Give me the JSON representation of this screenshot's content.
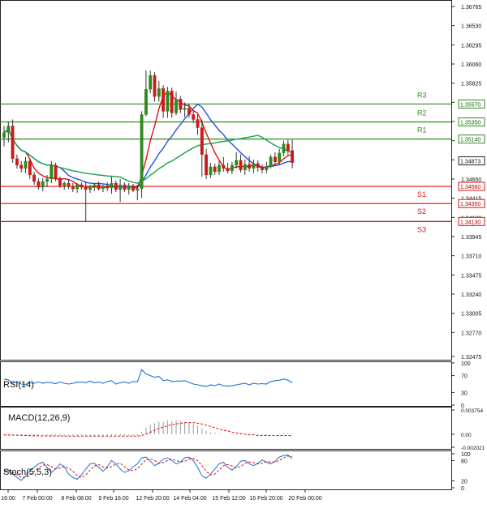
{
  "chart_data": [
    {
      "type": "candlestick",
      "title": "",
      "ylim": [
        1.32475,
        1.36765
      ],
      "y_ticks": [
        "1.36765",
        "1.36530",
        "1.36295",
        "1.36060",
        "1.35825",
        "1.35590",
        "1.35355",
        "1.35120",
        "1.34885",
        "1.34650",
        "1.34415",
        "1.34180",
        "1.33945",
        "1.33710",
        "1.33475",
        "1.33240",
        "1.33005",
        "1.32770",
        "1.32475"
      ],
      "x_ticks": [
        "16:00",
        "7 Feb 00:00",
        "8 Feb 08:00",
        "9 Feb 16:00",
        "12 Feb 20:00",
        "14 Feb 04:00",
        "15 Feb 12:00",
        "16 Feb 20:00",
        "20 Feb 00:00"
      ],
      "current_price": "1.34873",
      "levels": [
        {
          "name": "R3",
          "value": 1.3557,
          "label": "1.35570",
          "color": "#2e8b1e"
        },
        {
          "name": "R2",
          "value": 1.3535,
          "label": "1.35350",
          "color": "#2e8b1e"
        },
        {
          "name": "R1",
          "value": 1.3514,
          "label": "1.35140",
          "color": "#2e8b1e"
        },
        {
          "name": "S1",
          "value": 1.3456,
          "label": "1.34560",
          "color": "#e01010"
        },
        {
          "name": "S2",
          "value": 1.3435,
          "label": "1.34350",
          "color": "#e01010"
        },
        {
          "name": "S3",
          "value": 1.3413,
          "label": "1.34130",
          "color": "#e01010"
        }
      ],
      "candles": [
        {
          "o": 1.3516,
          "h": 1.353,
          "l": 1.3505,
          "c": 1.3522
        },
        {
          "o": 1.3522,
          "h": 1.3535,
          "l": 1.351,
          "c": 1.353
        },
        {
          "o": 1.353,
          "h": 1.3538,
          "l": 1.3485,
          "c": 1.349
        },
        {
          "o": 1.349,
          "h": 1.3495,
          "l": 1.3478,
          "c": 1.3482
        },
        {
          "o": 1.3482,
          "h": 1.3487,
          "l": 1.3473,
          "c": 1.3478
        },
        {
          "o": 1.3478,
          "h": 1.3492,
          "l": 1.3472,
          "c": 1.3487
        },
        {
          "o": 1.3487,
          "h": 1.349,
          "l": 1.3465,
          "c": 1.347
        },
        {
          "o": 1.347,
          "h": 1.3474,
          "l": 1.3458,
          "c": 1.3462
        },
        {
          "o": 1.3462,
          "h": 1.3466,
          "l": 1.3452,
          "c": 1.3455
        },
        {
          "o": 1.3455,
          "h": 1.3466,
          "l": 1.345,
          "c": 1.3462
        },
        {
          "o": 1.3462,
          "h": 1.347,
          "l": 1.3455,
          "c": 1.3465
        },
        {
          "o": 1.3465,
          "h": 1.3487,
          "l": 1.346,
          "c": 1.3482
        },
        {
          "o": 1.3482,
          "h": 1.3485,
          "l": 1.3462,
          "c": 1.3466
        },
        {
          "o": 1.3466,
          "h": 1.3468,
          "l": 1.3454,
          "c": 1.3457
        },
        {
          "o": 1.3457,
          "h": 1.3462,
          "l": 1.3452,
          "c": 1.346
        },
        {
          "o": 1.346,
          "h": 1.3465,
          "l": 1.3453,
          "c": 1.3456
        },
        {
          "o": 1.3456,
          "h": 1.346,
          "l": 1.3449,
          "c": 1.3453
        },
        {
          "o": 1.3453,
          "h": 1.346,
          "l": 1.3448,
          "c": 1.3458
        },
        {
          "o": 1.3458,
          "h": 1.3461,
          "l": 1.3452,
          "c": 1.3455
        },
        {
          "o": 1.3455,
          "h": 1.3462,
          "l": 1.3413,
          "c": 1.3452
        },
        {
          "o": 1.3452,
          "h": 1.3458,
          "l": 1.3448,
          "c": 1.3456
        },
        {
          "o": 1.3456,
          "h": 1.346,
          "l": 1.345,
          "c": 1.3458
        },
        {
          "o": 1.3458,
          "h": 1.3462,
          "l": 1.3451,
          "c": 1.3453
        },
        {
          "o": 1.3453,
          "h": 1.3458,
          "l": 1.3449,
          "c": 1.3456
        },
        {
          "o": 1.3456,
          "h": 1.3461,
          "l": 1.345,
          "c": 1.3454
        },
        {
          "o": 1.3454,
          "h": 1.3468,
          "l": 1.3447,
          "c": 1.346
        },
        {
          "o": 1.346,
          "h": 1.3463,
          "l": 1.3449,
          "c": 1.3452
        },
        {
          "o": 1.3452,
          "h": 1.3465,
          "l": 1.3437,
          "c": 1.3458
        },
        {
          "o": 1.3458,
          "h": 1.3461,
          "l": 1.3449,
          "c": 1.3452
        },
        {
          "o": 1.3452,
          "h": 1.346,
          "l": 1.3446,
          "c": 1.3457
        },
        {
          "o": 1.3457,
          "h": 1.3459,
          "l": 1.3449,
          "c": 1.3451
        },
        {
          "o": 1.3451,
          "h": 1.3458,
          "l": 1.3439,
          "c": 1.3453
        },
        {
          "o": 1.3453,
          "h": 1.3548,
          "l": 1.3442,
          "c": 1.3544
        },
        {
          "o": 1.3544,
          "h": 1.3598,
          "l": 1.3542,
          "c": 1.3575
        },
        {
          "o": 1.3575,
          "h": 1.3598,
          "l": 1.357,
          "c": 1.3592
        },
        {
          "o": 1.3592,
          "h": 1.3596,
          "l": 1.356,
          "c": 1.3566
        },
        {
          "o": 1.3566,
          "h": 1.3585,
          "l": 1.356,
          "c": 1.3576
        },
        {
          "o": 1.3576,
          "h": 1.358,
          "l": 1.354,
          "c": 1.3548
        },
        {
          "o": 1.3548,
          "h": 1.3578,
          "l": 1.354,
          "c": 1.3573
        },
        {
          "o": 1.3573,
          "h": 1.3577,
          "l": 1.354,
          "c": 1.3546
        },
        {
          "o": 1.3546,
          "h": 1.3572,
          "l": 1.3543,
          "c": 1.3563
        },
        {
          "o": 1.3563,
          "h": 1.3567,
          "l": 1.3546,
          "c": 1.355
        },
        {
          "o": 1.355,
          "h": 1.3559,
          "l": 1.3541,
          "c": 1.3552
        },
        {
          "o": 1.3552,
          "h": 1.3557,
          "l": 1.354,
          "c": 1.3544
        },
        {
          "o": 1.3544,
          "h": 1.3549,
          "l": 1.3534,
          "c": 1.3538
        },
        {
          "o": 1.3538,
          "h": 1.3544,
          "l": 1.3519,
          "c": 1.3528
        },
        {
          "o": 1.3528,
          "h": 1.3538,
          "l": 1.3468,
          "c": 1.3495
        },
        {
          "o": 1.3495,
          "h": 1.3502,
          "l": 1.3465,
          "c": 1.347
        },
        {
          "o": 1.347,
          "h": 1.3485,
          "l": 1.3466,
          "c": 1.348
        },
        {
          "o": 1.348,
          "h": 1.3484,
          "l": 1.347,
          "c": 1.3474
        },
        {
          "o": 1.3474,
          "h": 1.3487,
          "l": 1.347,
          "c": 1.3482
        },
        {
          "o": 1.3482,
          "h": 1.3492,
          "l": 1.3474,
          "c": 1.3478
        },
        {
          "o": 1.3478,
          "h": 1.3485,
          "l": 1.3472,
          "c": 1.3475
        },
        {
          "o": 1.3475,
          "h": 1.3486,
          "l": 1.3471,
          "c": 1.3482
        },
        {
          "o": 1.3482,
          "h": 1.3498,
          "l": 1.3478,
          "c": 1.3488
        },
        {
          "o": 1.3488,
          "h": 1.3495,
          "l": 1.3473,
          "c": 1.3476
        },
        {
          "o": 1.3476,
          "h": 1.3489,
          "l": 1.347,
          "c": 1.3483
        },
        {
          "o": 1.3483,
          "h": 1.3493,
          "l": 1.3474,
          "c": 1.3478
        },
        {
          "o": 1.3478,
          "h": 1.3489,
          "l": 1.3472,
          "c": 1.3484
        },
        {
          "o": 1.3484,
          "h": 1.3488,
          "l": 1.3474,
          "c": 1.3479
        },
        {
          "o": 1.3479,
          "h": 1.3483,
          "l": 1.3472,
          "c": 1.3476
        },
        {
          "o": 1.3476,
          "h": 1.3486,
          "l": 1.3472,
          "c": 1.348
        },
        {
          "o": 1.348,
          "h": 1.3495,
          "l": 1.3478,
          "c": 1.3492
        },
        {
          "o": 1.3492,
          "h": 1.3498,
          "l": 1.3483,
          "c": 1.3486
        },
        {
          "o": 1.3486,
          "h": 1.3502,
          "l": 1.3482,
          "c": 1.3497
        },
        {
          "o": 1.3497,
          "h": 1.3512,
          "l": 1.3493,
          "c": 1.3508
        },
        {
          "o": 1.3508,
          "h": 1.3513,
          "l": 1.3495,
          "c": 1.35
        },
        {
          "o": 1.35,
          "h": 1.3513,
          "l": 1.3478,
          "c": 1.3485
        }
      ],
      "ma_fast_color": "#e01010",
      "ma_mid_color": "#2a4fd8",
      "ma_slow_color": "#17a34a",
      "bull_color": "#2e8b1e",
      "bear_color": "#cc1a1a"
    },
    {
      "type": "line",
      "name": "RSI(14)",
      "label": "RSI(14)",
      "ylim": [
        0,
        100
      ],
      "y_ticks": [
        "100",
        "70",
        "30",
        "0"
      ],
      "values": [
        62,
        60,
        52,
        55,
        50,
        49,
        53,
        52,
        55,
        52,
        54,
        53,
        51,
        55,
        52,
        50,
        52,
        54,
        55,
        53,
        57,
        53,
        55,
        52,
        56,
        58,
        50,
        53,
        55,
        52,
        56,
        55,
        84,
        74,
        70,
        66,
        68,
        58,
        60,
        56,
        57,
        57,
        58,
        54,
        50,
        48,
        46,
        44,
        48,
        46,
        50,
        46,
        45,
        46,
        48,
        50,
        52,
        48,
        52,
        50,
        51,
        50,
        56,
        58,
        59,
        62,
        59,
        53
      ],
      "color": "#1f6fd6"
    },
    {
      "type": "bar",
      "name": "MACD(12,26,9)",
      "label": "MACD(12,26,9)",
      "ylim": [
        -0.002021,
        0.003754
      ],
      "y_ticks": [
        "0.003754",
        "0.00",
        "-0.002021"
      ],
      "histogram": [
        -0.0002,
        -0.0002,
        -0.0002,
        -0.0002,
        -0.0003,
        -0.0003,
        -0.0003,
        -0.0003,
        -0.0003,
        -0.0003,
        -0.0003,
        -0.0003,
        -0.0003,
        -0.0003,
        -0.0003,
        -0.0003,
        -0.0003,
        -0.0003,
        -0.0003,
        -0.0003,
        -0.0003,
        -0.0003,
        -0.0003,
        -0.0003,
        -0.0003,
        -0.0003,
        -0.0003,
        -0.0003,
        -0.0003,
        -0.0003,
        -0.0003,
        -0.0003,
        0.0004,
        0.001,
        0.0015,
        0.0017,
        0.0019,
        0.0019,
        0.0021,
        0.002,
        0.0021,
        0.002,
        0.0019,
        0.0018,
        0.0016,
        0.0013,
        0.0009,
        0.0005,
        0.0003,
        0.0002,
        0.0001,
        0.0,
        0.0,
        -0.0001,
        -0.0001,
        -0.0001,
        -0.0001,
        -0.0001,
        -0.0001,
        -0.0001,
        -0.0001,
        -0.0001,
        0.0,
        0.0,
        0.0001,
        0.0002,
        0.0002,
        0.0001
      ],
      "signal": [
        -0.0001,
        -0.00012,
        -0.00014,
        -0.00016,
        -0.00018,
        -0.0002,
        -0.00022,
        -0.00024,
        -0.00025,
        -0.00026,
        -0.00027,
        -0.00028,
        -0.00028,
        -0.00029,
        -0.00029,
        -0.0003,
        -0.0003,
        -0.0003,
        -0.0003,
        -0.0003,
        -0.0003,
        -0.0003,
        -0.0003,
        -0.0003,
        -0.0003,
        -0.0003,
        -0.0003,
        -0.0003,
        -0.0003,
        -0.0003,
        -0.0003,
        -0.0003,
        -0.0002,
        0.0,
        0.0003,
        0.0006,
        0.0009,
        0.0011,
        0.0013,
        0.0015,
        0.0016,
        0.0017,
        0.0018,
        0.0018,
        0.0018,
        0.0017,
        0.0016,
        0.0014,
        0.0012,
        0.001,
        0.0008,
        0.0006,
        0.0005,
        0.0003,
        0.0002,
        0.0001,
        0.0,
        -0.0001,
        -0.0001,
        -0.0002,
        -0.0002,
        -0.0002,
        -0.0002,
        -0.0002,
        -0.0002,
        -0.0002,
        -0.0002,
        -0.0002
      ],
      "histogram_color": "#9a9a9a",
      "signal_color": "#e01010"
    },
    {
      "type": "line",
      "name": "Stoch(5,5,3)",
      "label": "Stoch(5,5,3)",
      "ylim": [
        0,
        100
      ],
      "y_ticks": [
        "100",
        "80",
        "20",
        "0"
      ],
      "series": [
        {
          "values": [
            45,
            52,
            40,
            30,
            22,
            35,
            50,
            60,
            70,
            75,
            60,
            45,
            55,
            70,
            62,
            40,
            30,
            25,
            38,
            55,
            70,
            72,
            60,
            48,
            62,
            80,
            70,
            55,
            45,
            50,
            62,
            70,
            88,
            90,
            78,
            65,
            72,
            84,
            88,
            80,
            70,
            75,
            88,
            90,
            80,
            60,
            35,
            28,
            40,
            55,
            70,
            75,
            60,
            52,
            62,
            78,
            80,
            70,
            65,
            72,
            82,
            75,
            70,
            78,
            90,
            95,
            96,
            85
          ],
          "color": "#1f6fd6",
          "dashed": false
        },
        {
          "values": [
            50,
            50,
            45,
            38,
            30,
            30,
            38,
            48,
            58,
            66,
            68,
            62,
            55,
            58,
            62,
            58,
            48,
            36,
            30,
            38,
            52,
            64,
            68,
            62,
            58,
            62,
            70,
            72,
            62,
            52,
            50,
            56,
            70,
            82,
            85,
            80,
            72,
            74,
            80,
            84,
            80,
            76,
            78,
            84,
            86,
            80,
            65,
            48,
            38,
            40,
            52,
            65,
            68,
            64,
            58,
            62,
            72,
            76,
            74,
            70,
            72,
            76,
            76,
            75,
            80,
            88,
            93,
            92
          ],
          "color": "#e01010",
          "dashed": true
        }
      ]
    }
  ]
}
